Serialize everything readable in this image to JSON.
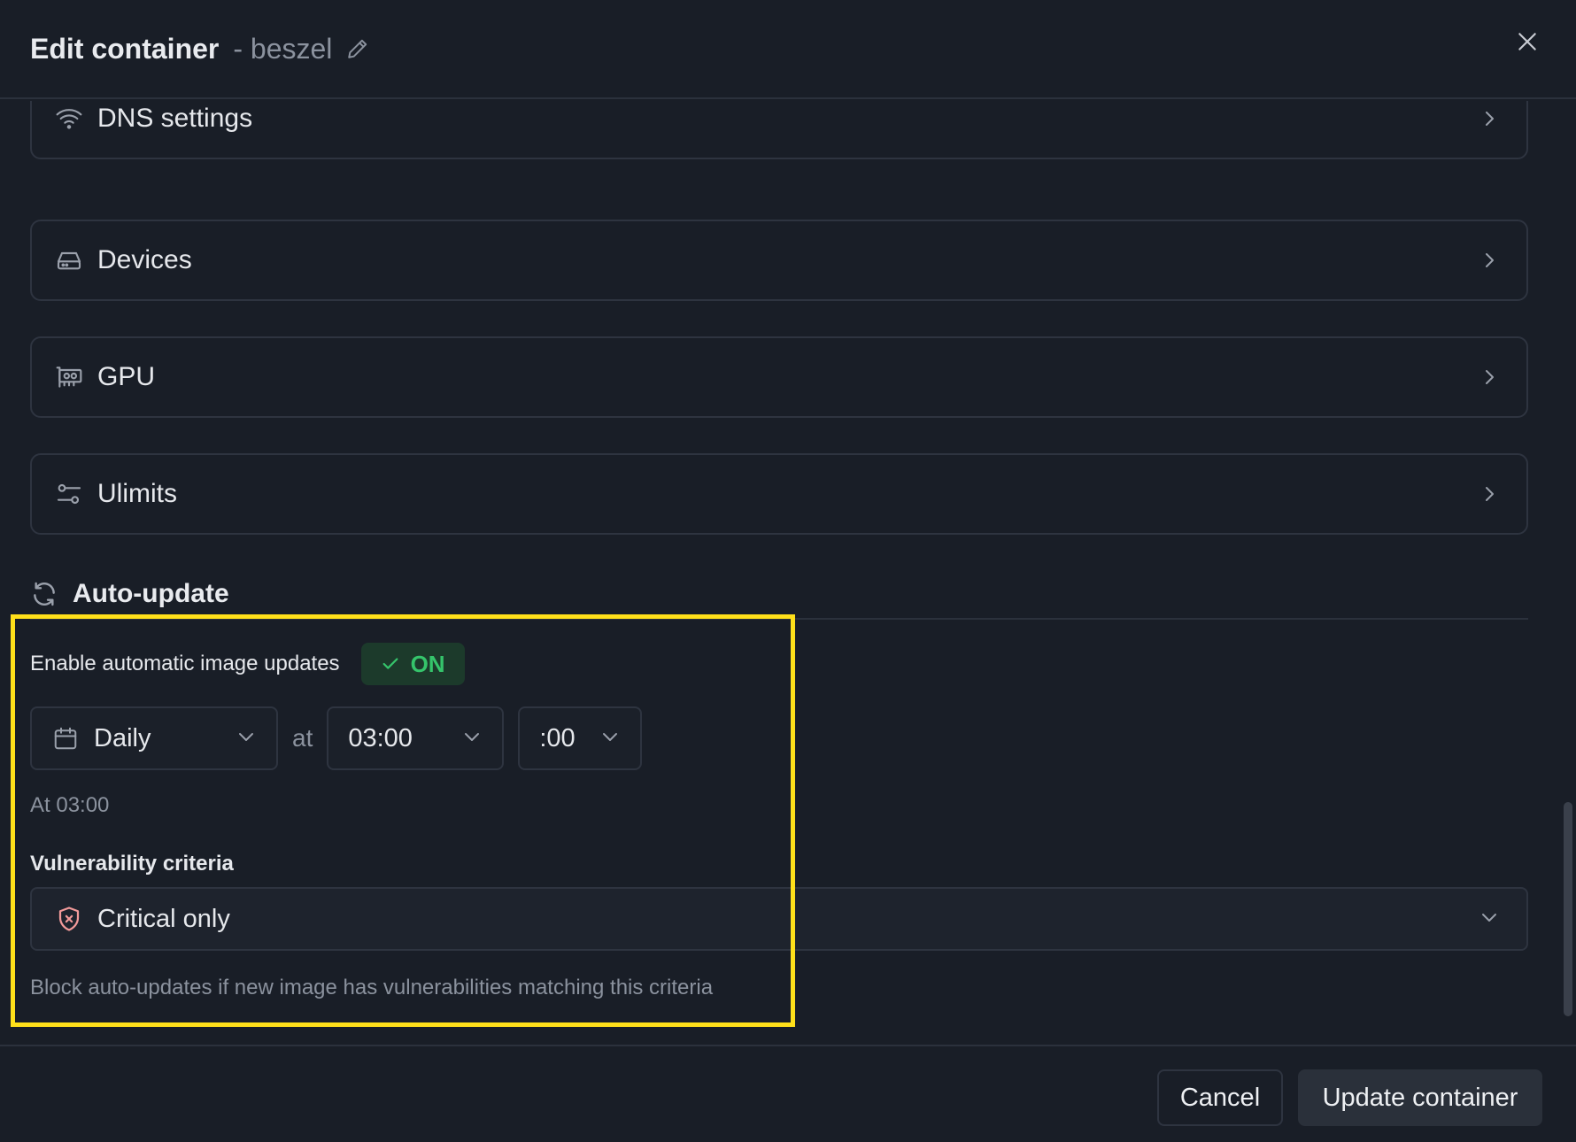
{
  "header": {
    "title": "Edit container",
    "subtitle": "- beszel",
    "edit_icon": "pencil-icon",
    "close_icon": "close-icon"
  },
  "sections": [
    {
      "label": "DNS settings",
      "icon": "wifi-icon"
    },
    {
      "label": "Devices",
      "icon": "hard-drive-icon"
    },
    {
      "label": "GPU",
      "icon": "gpu-icon"
    },
    {
      "label": "Ulimits",
      "icon": "sliders-icon"
    }
  ],
  "auto_update": {
    "title": "Auto-update",
    "icon": "refresh-icon",
    "enable_label": "Enable automatic image updates",
    "toggle_label": "ON",
    "toggle_state": true,
    "frequency": "Daily",
    "at_label": "at",
    "hour": "03:00",
    "minute": ":00",
    "schedule_summary": "At 03:00",
    "vulnerability_label": "Vulnerability criteria",
    "vulnerability_value": "Critical only",
    "vulnerability_help": "Block auto-updates if new image has vulnerabilities matching this criteria"
  },
  "footer": {
    "cancel_label": "Cancel",
    "submit_label": "Update container"
  },
  "colors": {
    "background": "#191e27",
    "border": "#2e3440",
    "toggle_on_bg": "#1c3a2b",
    "toggle_on_fg": "#35c46b",
    "highlight": "#ffe01a"
  }
}
